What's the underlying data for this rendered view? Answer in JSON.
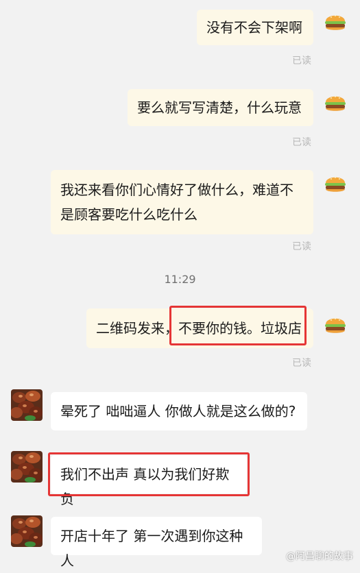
{
  "messages": {
    "m1": "没有不会下架啊",
    "m2": "要么就写写清楚，什么玩意",
    "m3_line1": "我还来看你们心情好了做什么，难道不",
    "m3_line2": "是顾客要吃什么吃什么",
    "m4": "二维码发来，不要你的钱。垃圾店",
    "m5": "晕死了 咄咄逼人 你做人就是这么做的?",
    "m6": "我们不出声 真以为我们好欺负",
    "m7": "开店十年了 第一次遇到你这种人"
  },
  "status": {
    "read": "已读"
  },
  "timestamp": "11:29",
  "watermark": "@阿昌聊的故事",
  "colors": {
    "outgoing_bubble": "#fdf8e7",
    "incoming_bubble": "#ffffff",
    "highlight_box": "#e53535",
    "background": "#f2f2f2"
  },
  "icons": {
    "self_avatar": "burger-avatar-icon",
    "other_avatar": "food-photo-avatar"
  }
}
